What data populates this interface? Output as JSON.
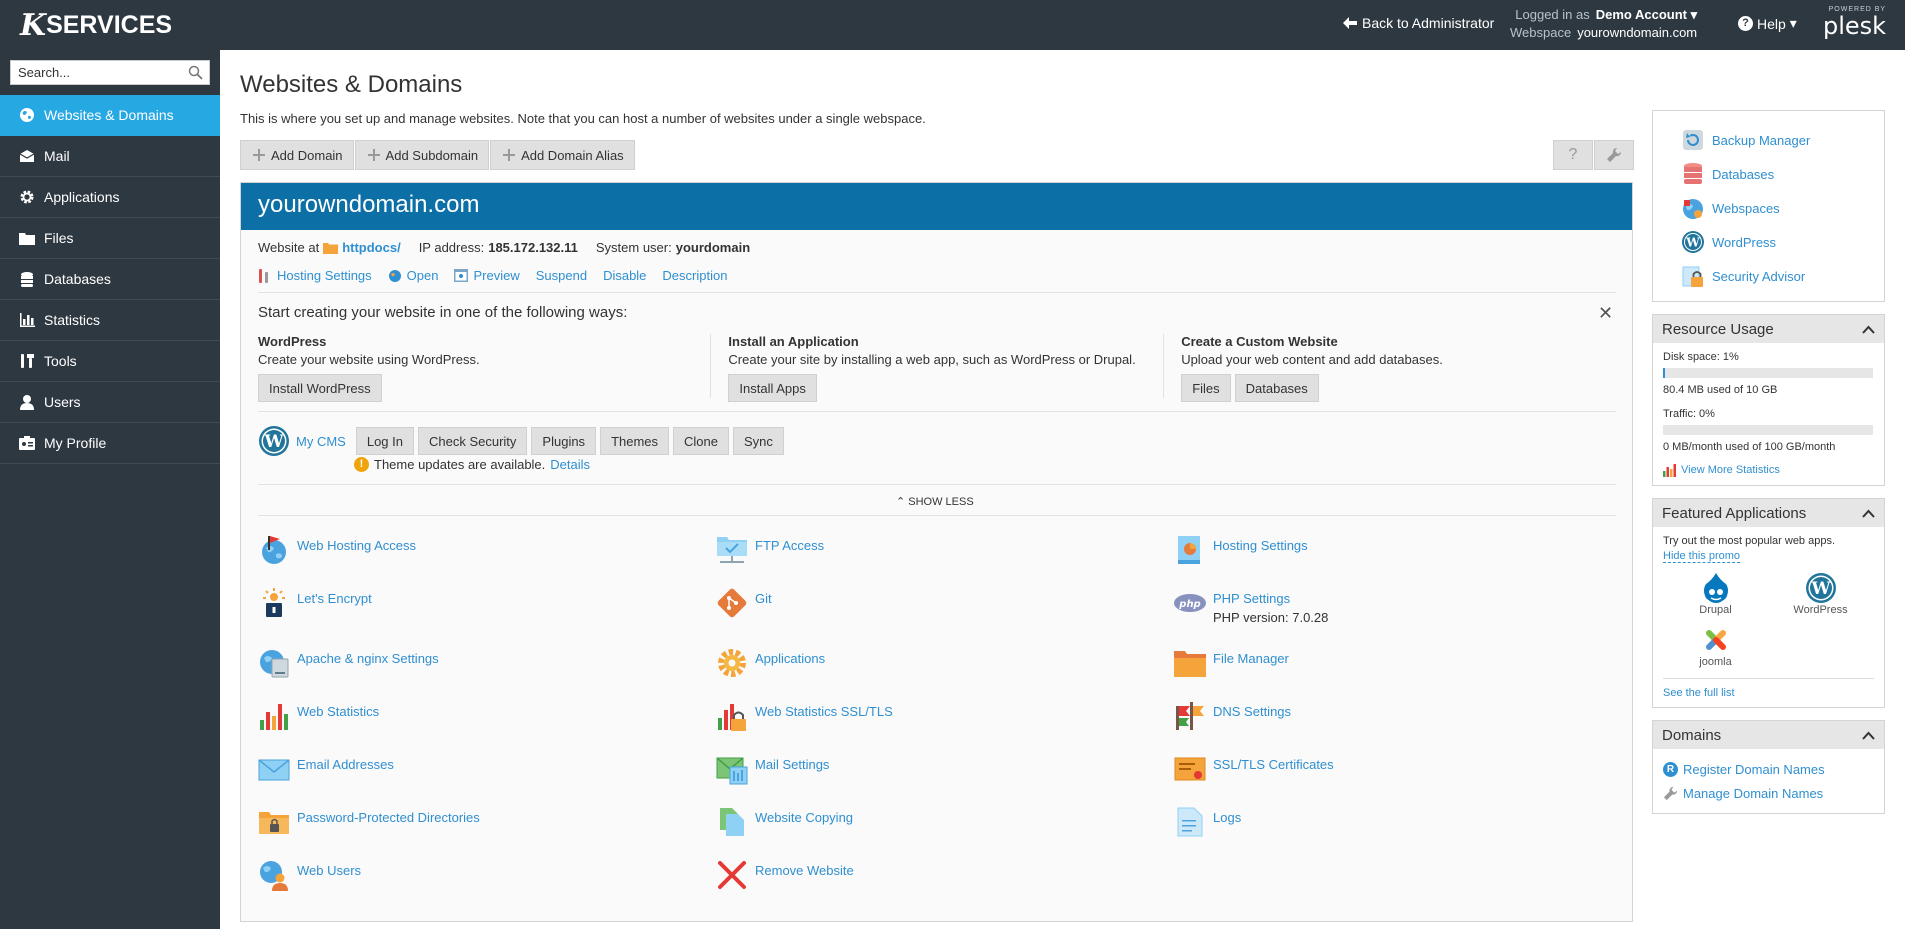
{
  "header": {
    "logo_mark": "K",
    "logo_word": "SERVICES",
    "back_label": "Back to Administrator",
    "logged_in_label": "Logged in as",
    "account": "Demo Account",
    "webspace_label": "Webspace",
    "webspace": "yourowndomain.com",
    "help_label": "Help",
    "powered_by": "POWERED BY",
    "plesk": "plesk"
  },
  "sidebar": {
    "search_placeholder": "Search...",
    "items": [
      {
        "label": "Websites & Domains",
        "icon": "globe-icon",
        "active": true
      },
      {
        "label": "Mail",
        "icon": "mail-icon"
      },
      {
        "label": "Applications",
        "icon": "gear-icon"
      },
      {
        "label": "Files",
        "icon": "folder-icon"
      },
      {
        "label": "Databases",
        "icon": "database-icon"
      },
      {
        "label": "Statistics",
        "icon": "bar-chart-icon"
      },
      {
        "label": "Tools",
        "icon": "tools-icon"
      },
      {
        "label": "Users",
        "icon": "user-icon"
      },
      {
        "label": "My Profile",
        "icon": "profile-icon"
      }
    ]
  },
  "main": {
    "title": "Websites & Domains",
    "description": "This is where you set up and manage websites. Note that you can host a number of websites under a single webspace.",
    "toolbar": [
      "Add Domain",
      "Add Subdomain",
      "Add Domain Alias"
    ],
    "domain": {
      "name": "yourowndomain.com",
      "website_at_label": "Website at",
      "website_at": "httpdocs/",
      "ip_label": "IP address:",
      "ip": "185.172.132.11",
      "sysuser_label": "System user:",
      "sysuser": "yourdomain",
      "actions": [
        "Hosting Settings",
        "Open",
        "Preview",
        "Suspend",
        "Disable",
        "Description"
      ],
      "start_title": "Start creating your website in one of the following ways:",
      "ways": [
        {
          "title": "WordPress",
          "desc": "Create your website using WordPress.",
          "buttons": [
            "Install WordPress"
          ]
        },
        {
          "title": "Install an Application",
          "desc": "Create your site by installing a web app, such as WordPress or Drupal.",
          "buttons": [
            "Install Apps"
          ]
        },
        {
          "title": "Create a Custom Website",
          "desc": "Upload your web content and add databases.",
          "buttons": [
            "Files",
            "Databases"
          ]
        }
      ],
      "cms_label": "My CMS",
      "cms_buttons": [
        "Log In",
        "Check Security",
        "Plugins",
        "Themes",
        "Clone",
        "Sync"
      ],
      "notice": "Theme updates are available.",
      "notice_link": "Details",
      "show_less": "SHOW LESS",
      "tools": [
        {
          "label": "Web Hosting Access",
          "icon": "web-hosting-access-icon"
        },
        {
          "label": "FTP Access",
          "icon": "ftp-access-icon"
        },
        {
          "label": "Hosting Settings",
          "icon": "hosting-settings-icon"
        },
        {
          "label": "Let's Encrypt",
          "icon": "lets-encrypt-icon"
        },
        {
          "label": "Git",
          "icon": "git-icon"
        },
        {
          "label": "PHP Settings",
          "icon": "php-icon",
          "sub": "PHP version: 7.0.28"
        },
        {
          "label": "Apache & nginx Settings",
          "icon": "apache-nginx-icon"
        },
        {
          "label": "Applications",
          "icon": "applications-gear-icon"
        },
        {
          "label": "File Manager",
          "icon": "file-manager-icon"
        },
        {
          "label": "Web Statistics",
          "icon": "web-statistics-icon"
        },
        {
          "label": "Web Statistics SSL/TLS",
          "icon": "web-statistics-ssl-icon"
        },
        {
          "label": "DNS Settings",
          "icon": "dns-settings-icon"
        },
        {
          "label": "Email Addresses",
          "icon": "email-addresses-icon"
        },
        {
          "label": "Mail Settings",
          "icon": "mail-settings-icon"
        },
        {
          "label": "SSL/TLS Certificates",
          "icon": "ssl-certificates-icon"
        },
        {
          "label": "Password-Protected Directories",
          "icon": "password-dirs-icon"
        },
        {
          "label": "Website Copying",
          "icon": "website-copying-icon"
        },
        {
          "label": "Logs",
          "icon": "logs-icon"
        },
        {
          "label": "Web Users",
          "icon": "web-users-icon"
        },
        {
          "label": "Remove Website",
          "icon": "remove-website-icon"
        }
      ]
    }
  },
  "right": {
    "links": [
      {
        "label": "Backup Manager",
        "icon": "backup-icon"
      },
      {
        "label": "Databases",
        "icon": "databases-icon"
      },
      {
        "label": "Webspaces",
        "icon": "webspaces-icon"
      },
      {
        "label": "WordPress",
        "icon": "wordpress-icon"
      },
      {
        "label": "Security Advisor",
        "icon": "security-advisor-icon"
      }
    ],
    "resource": {
      "title": "Resource Usage",
      "disk_label": "Disk space: 1%",
      "disk_fraction": 0.01,
      "disk_detail": "80.4 MB used of 10 GB",
      "traffic_label": "Traffic: 0%",
      "traffic_fraction": 0.0,
      "traffic_detail": "0 MB/month used of 100 GB/month",
      "more_stats": "View More Statistics"
    },
    "featured": {
      "title": "Featured Applications",
      "desc": "Try out the most popular web apps.",
      "hide": "Hide this promo",
      "apps": [
        "Drupal",
        "WordPress",
        "joomla"
      ],
      "full_list": "See the full list"
    },
    "domains": {
      "title": "Domains",
      "links": [
        "Register Domain Names",
        "Manage Domain Names"
      ]
    }
  }
}
